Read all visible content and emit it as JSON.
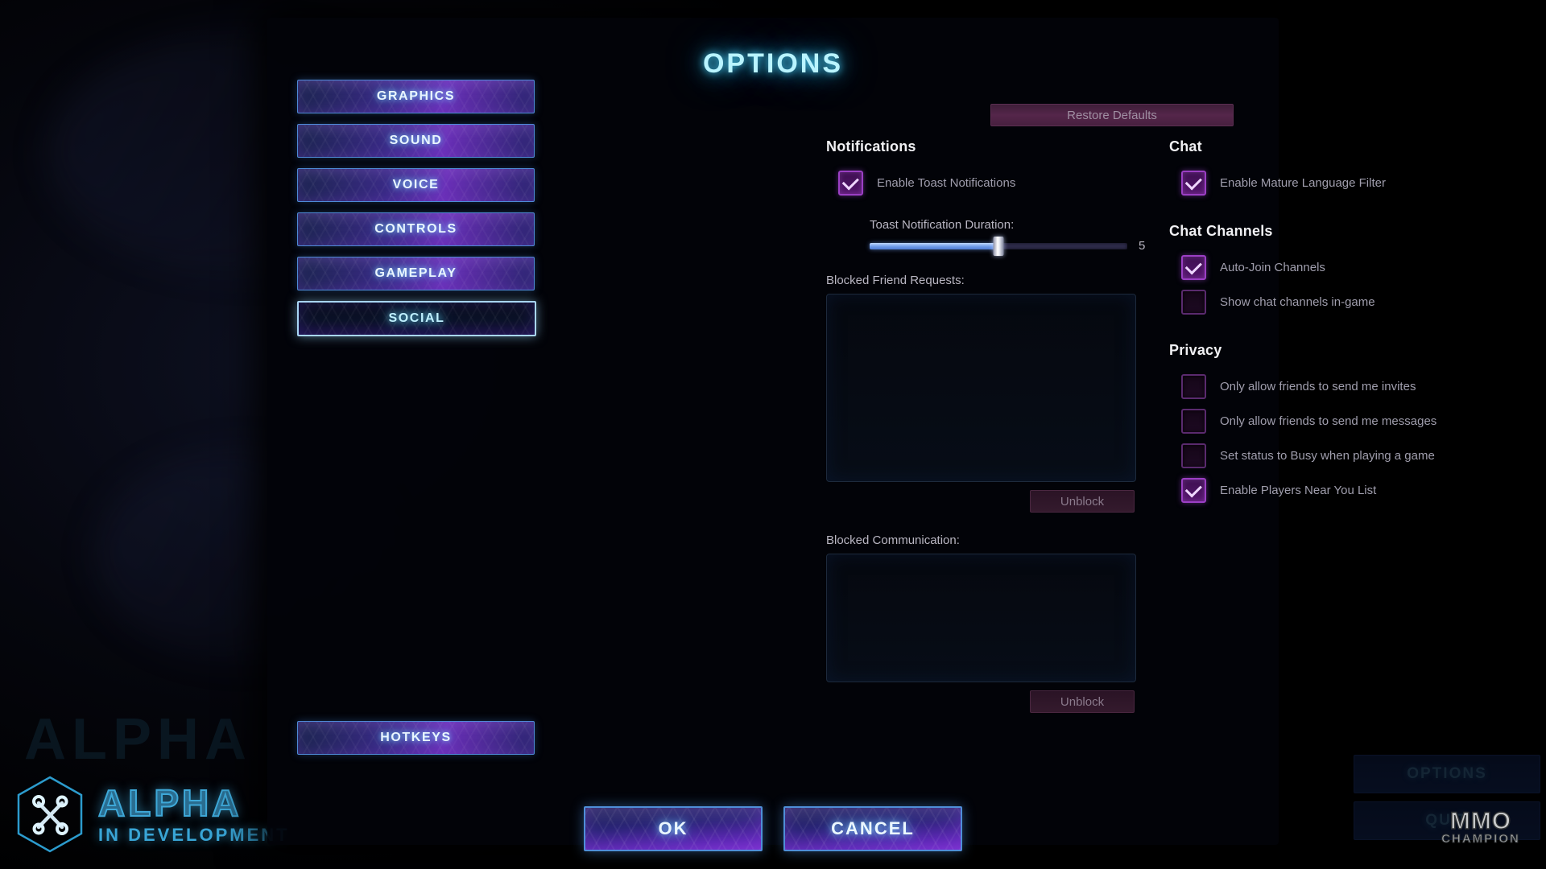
{
  "background": {
    "menu_buttons": [
      {
        "label": "OPTIONS"
      },
      {
        "label": "QUIT"
      }
    ],
    "watermark": {
      "ghost_title": "ALPHA",
      "title": "ALPHA",
      "subtitle": "IN DEVELOPMENT",
      "icon": "crossed-tools-hexagon-icon"
    },
    "site_logo": {
      "line1": "MMO",
      "line2": "CHAMPION"
    }
  },
  "dialog": {
    "title": "OPTIONS",
    "restore_defaults_label": "Restore Defaults",
    "tabs": [
      {
        "label": "GRAPHICS",
        "selected": false
      },
      {
        "label": "SOUND",
        "selected": false
      },
      {
        "label": "VOICE",
        "selected": false
      },
      {
        "label": "CONTROLS",
        "selected": false
      },
      {
        "label": "GAMEPLAY",
        "selected": false
      },
      {
        "label": "SOCIAL",
        "selected": true
      }
    ],
    "hotkeys_label": "HOTKEYS",
    "notifications": {
      "heading": "Notifications",
      "enable_toast": {
        "label": "Enable Toast Notifications",
        "checked": true
      },
      "duration": {
        "label": "Toast Notification Duration:",
        "value": "5",
        "percent": 50,
        "min": 0,
        "max": 10
      },
      "blocked_friend_requests": {
        "label": "Blocked Friend Requests:",
        "items": [],
        "unblock_label": "Unblock"
      },
      "blocked_communication": {
        "label": "Blocked Communication:",
        "items": [],
        "unblock_label": "Unblock"
      }
    },
    "chat": {
      "heading": "Chat",
      "options": [
        {
          "label": "Enable Mature Language Filter",
          "checked": true
        }
      ]
    },
    "chat_channels": {
      "heading": "Chat Channels",
      "options": [
        {
          "label": "Auto-Join Channels",
          "checked": true
        },
        {
          "label": "Show chat channels in-game",
          "checked": false
        }
      ]
    },
    "privacy": {
      "heading": "Privacy",
      "options": [
        {
          "label": "Only allow friends to send me invites",
          "checked": false
        },
        {
          "label": "Only allow friends to send me messages",
          "checked": false
        },
        {
          "label": "Set status to Busy when playing a game",
          "checked": false
        },
        {
          "label": "Enable Players Near You List",
          "checked": true
        }
      ]
    },
    "footer": {
      "ok_label": "OK",
      "cancel_label": "CANCEL"
    }
  },
  "colors": {
    "title_cyan": "#b9f4ff",
    "accent_purple": "#6b2fb8",
    "border_blue": "#4e8ad6",
    "checkbox_on": "#9b3fc4",
    "restore_magenta": "#55264a",
    "alpha_teal": "#39a5d6"
  }
}
